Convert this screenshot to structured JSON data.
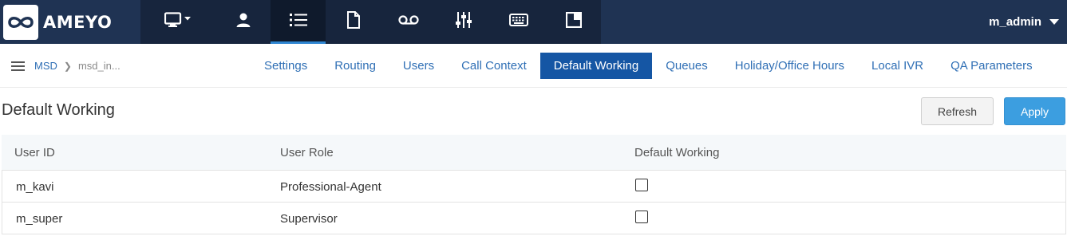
{
  "header": {
    "logo_text": "AMEYO",
    "nav_icons": [
      "monitor-icon",
      "user-icon",
      "list-icon",
      "document-icon",
      "voicemail-icon",
      "sliders-icon",
      "keyboard-icon",
      "window-icon"
    ],
    "active_nav": "list-icon",
    "user_name": "m_admin"
  },
  "subheader": {
    "breadcrumb": [
      "MSD",
      "msd_in..."
    ],
    "tabs": [
      "Settings",
      "Routing",
      "Users",
      "Call Context",
      "Default Working",
      "Queues",
      "Holiday/Office Hours",
      "Local IVR",
      "QA Parameters"
    ],
    "active_tab": "Default Working"
  },
  "page": {
    "title": "Default Working",
    "refresh_label": "Refresh",
    "apply_label": "Apply"
  },
  "table": {
    "columns": [
      "User ID",
      "User Role",
      "Default Working"
    ],
    "rows": [
      {
        "user_id": "m_kavi",
        "user_role": "Professional-Agent",
        "default_working": false
      },
      {
        "user_id": "m_super",
        "user_role": "Supervisor",
        "default_working": false
      }
    ]
  },
  "colors": {
    "topbar": "#1f3353",
    "nav_bg": "#17253d",
    "accent": "#2f86d2",
    "active_tab": "#1556a4",
    "apply_button": "#3c9ee0",
    "link": "#2f6fb5"
  }
}
